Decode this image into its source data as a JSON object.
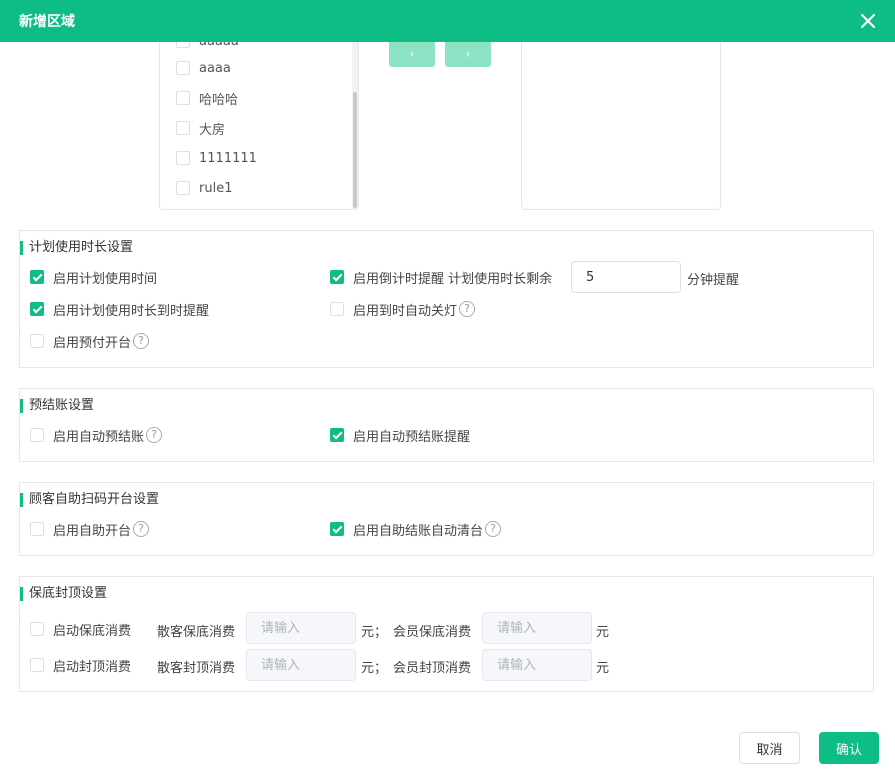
{
  "dialog": {
    "title": "新增区域"
  },
  "transfer": {
    "left_items": [
      {
        "label": "aaaaa",
        "checked": false
      },
      {
        "label": "aaaa",
        "checked": false
      },
      {
        "label": "哈哈哈",
        "checked": false
      },
      {
        "label": "大房",
        "checked": false
      },
      {
        "label": "1111111",
        "checked": false
      },
      {
        "label": "rule1",
        "checked": false
      }
    ],
    "move_left_label": "‹",
    "move_right_label": "›"
  },
  "plan_usage": {
    "title": "计划使用时长设置",
    "enable_plan_time": {
      "label": "启用计划使用时间",
      "checked": true
    },
    "enable_countdown": {
      "label": "启用倒计时提醒 计划使用时长剩余",
      "checked": true
    },
    "remaining_minutes": "5",
    "minutes_suffix": "分钟提醒",
    "enable_due_reminder": {
      "label": "启用计划使用时长到时提醒",
      "checked": true
    },
    "enable_auto_light_off": {
      "label": "启用到时自动关灯",
      "checked": false
    },
    "enable_prepaid": {
      "label": "启用预付开台",
      "checked": false
    }
  },
  "pre_checkout": {
    "title": "预结账设置",
    "enable_auto_pre_checkout": {
      "label": "启用自动预结账",
      "checked": false
    },
    "enable_auto_pre_checkout_reminder": {
      "label": "启用自动预结账提醒",
      "checked": true
    }
  },
  "self_service": {
    "title": "顾客自助扫码开台设置",
    "enable_self_open": {
      "label": "启用自助开台",
      "checked": false
    },
    "enable_self_checkout_clear": {
      "label": "启用自助结账自动清台",
      "checked": true
    }
  },
  "min_max": {
    "title": "保底封顶设置",
    "enable_min_spend": {
      "label": "启动保底消费",
      "checked": false
    },
    "enable_max_spend": {
      "label": "启动封顶消费",
      "checked": false
    },
    "guest_min_label": "散客保底消费",
    "member_min_label": "会员保底消费",
    "guest_max_label": "散客封顶消费",
    "member_max_label": "会员封顶消费",
    "placeholder": "请输入",
    "unit_sep": "元；",
    "unit": "元"
  },
  "help_glyph": "?",
  "footer": {
    "cancel_label": "取消",
    "confirm_label": "确认"
  },
  "colors": {
    "accent": "#0ebc85",
    "arrow_disabled": "#8be3c3"
  }
}
